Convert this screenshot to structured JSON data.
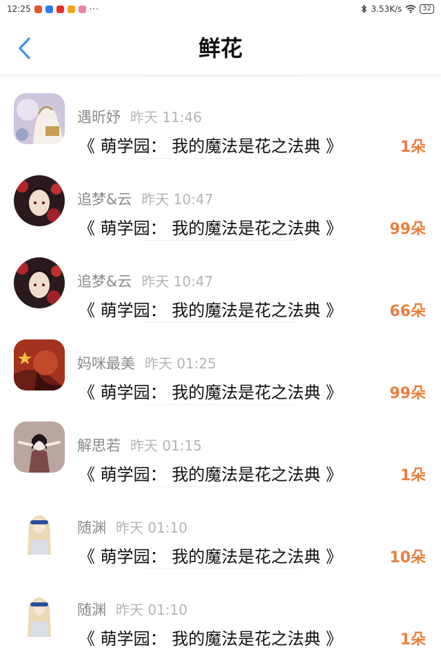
{
  "status_bar": {
    "time": "12:25",
    "dots": "···",
    "network_speed": "3.53K/s",
    "battery": "32",
    "app_icon_colors": [
      "#e9542c",
      "#2f7bf6",
      "#e3302b",
      "#f2a51a",
      "#f07fa3"
    ]
  },
  "nav": {
    "title": "鲜花",
    "back_icon": "chevron-left-icon",
    "accent": "#3d92e6"
  },
  "items": [
    {
      "name": "遇昕妤",
      "time": "昨天 11:46",
      "book": "《 萌学园： 我的魔法是花之法典 》",
      "qty": "1朵"
    },
    {
      "name": "追梦&云",
      "time": "昨天 10:47",
      "book": "《 萌学园： 我的魔法是花之法典 》",
      "qty": "99朵"
    },
    {
      "name": "追梦&云",
      "time": "昨天 10:47",
      "book": "《 萌学园： 我的魔法是花之法典 》",
      "qty": "66朵"
    },
    {
      "name": "妈咪最美",
      "time": "昨天 01:25",
      "book": "《 萌学园： 我的魔法是花之法典 》",
      "qty": "99朵"
    },
    {
      "name": "解思若",
      "time": "昨天 01:15",
      "book": "《 萌学园： 我的魔法是花之法典 》",
      "qty": "1朵"
    },
    {
      "name": "随渊",
      "time": "昨天 01:10",
      "book": "《 萌学园： 我的魔法是花之法典 》",
      "qty": "10朵"
    },
    {
      "name": "随渊",
      "time": "昨天 01:10",
      "book": "《 萌学园： 我的魔法是花之法典 》",
      "qty": "1朵"
    }
  ],
  "colors": {
    "quantity": "#e8803f",
    "name": "#8a8a8a",
    "time": "#b5b5b5"
  }
}
